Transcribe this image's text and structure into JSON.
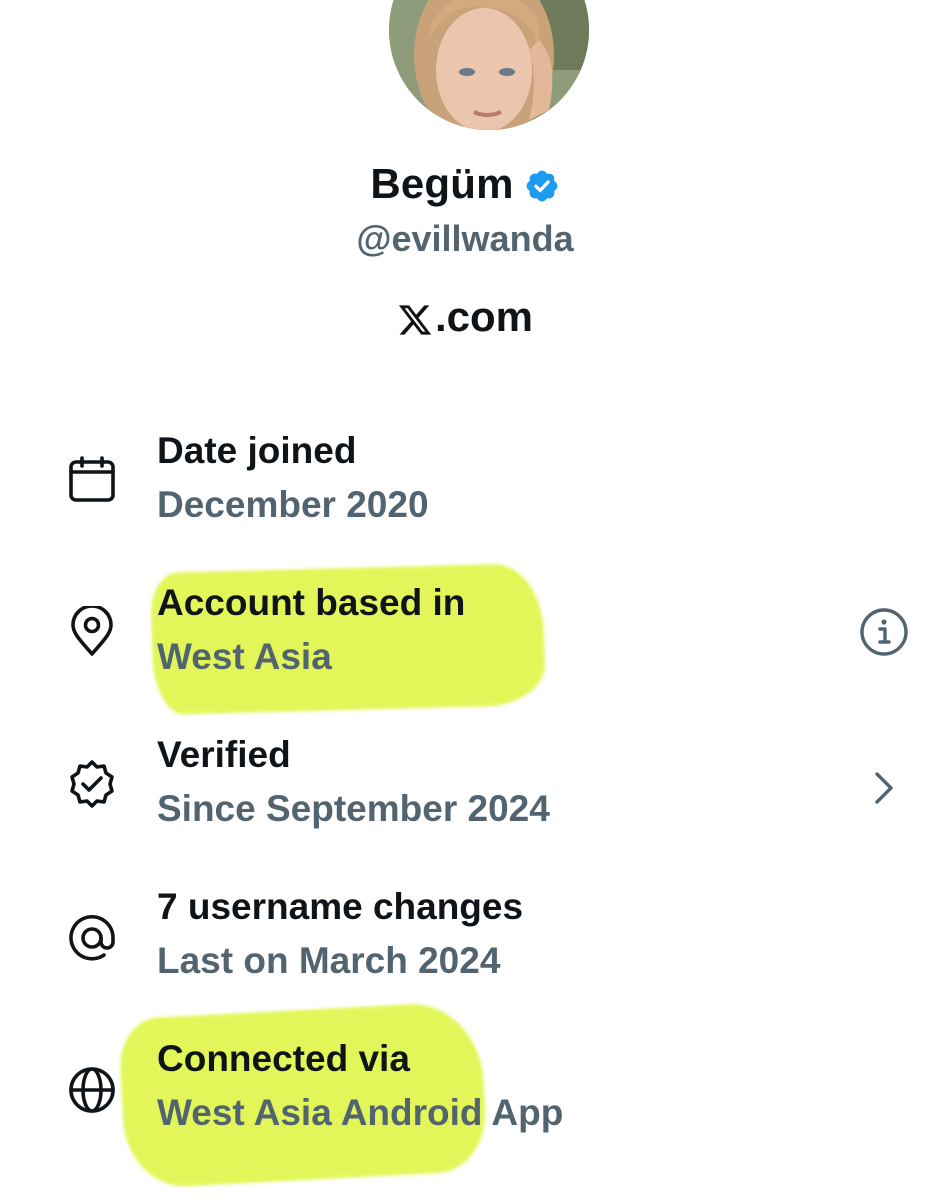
{
  "profile": {
    "display_name": "Begüm",
    "handle": "@evillwanda",
    "website": ".com",
    "website_logo": "x-logo-icon"
  },
  "badge": {
    "icon": "verified-badge-icon",
    "color": "#1d9bf0"
  },
  "highlight_color": "#dff53c",
  "about": {
    "rows": [
      {
        "icon": "calendar-icon",
        "title": "Date joined",
        "value": "December 2020",
        "action": ""
      },
      {
        "icon": "location-pin-icon",
        "title": "Account based in",
        "value": "West Asia",
        "action": "info-icon"
      },
      {
        "icon": "verified-check-icon",
        "title": "Verified",
        "value": "Since September 2024",
        "action": "chevron-right-icon"
      },
      {
        "icon": "at-sign-icon",
        "title": "7 username changes",
        "value": "Last on March 2024",
        "action": ""
      },
      {
        "icon": "globe-icon",
        "title": "Connected via",
        "value": "West Asia Android App",
        "action": ""
      }
    ]
  }
}
